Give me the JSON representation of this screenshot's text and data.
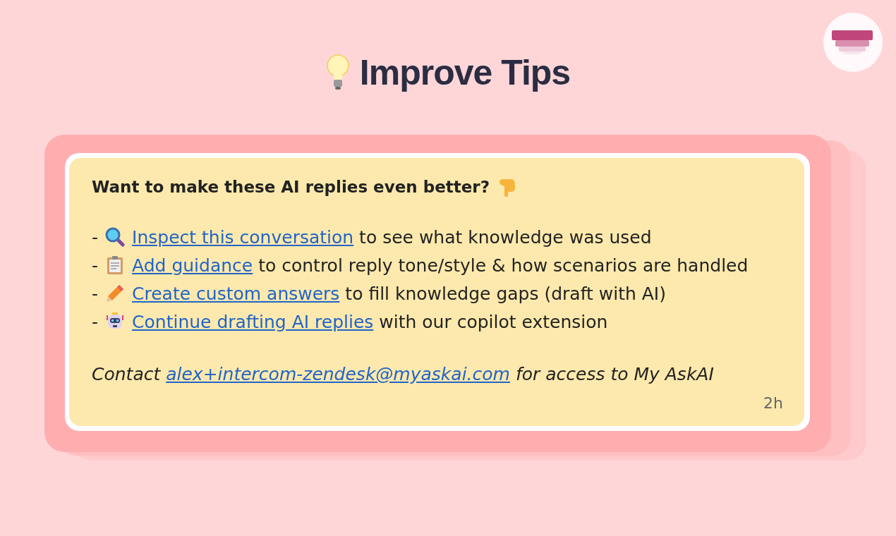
{
  "title": "Improve Tips",
  "message": {
    "heading": "Want to make these AI replies even better?",
    "tips": [
      {
        "kind": "magnifier",
        "dash": "-",
        "link": "Inspect this conversation",
        "rest": "to see what knowledge was used"
      },
      {
        "kind": "clipboard",
        "dash": "-",
        "link": "Add guidance",
        "rest": "to control reply tone/style & how scenarios are handled"
      },
      {
        "kind": "pencil",
        "dash": "-",
        "link": "Create custom answers",
        "rest": "to fill knowledge gaps (draft with AI)"
      },
      {
        "kind": "robot",
        "dash": "-",
        "link": "Continue drafting AI replies",
        "rest": "with our copilot extension"
      }
    ],
    "contact": {
      "prefix": "Contact",
      "link": "alex+intercom-zendesk@myaskai.com",
      "suffix": "for access to My AskAI"
    },
    "time": "2h"
  }
}
